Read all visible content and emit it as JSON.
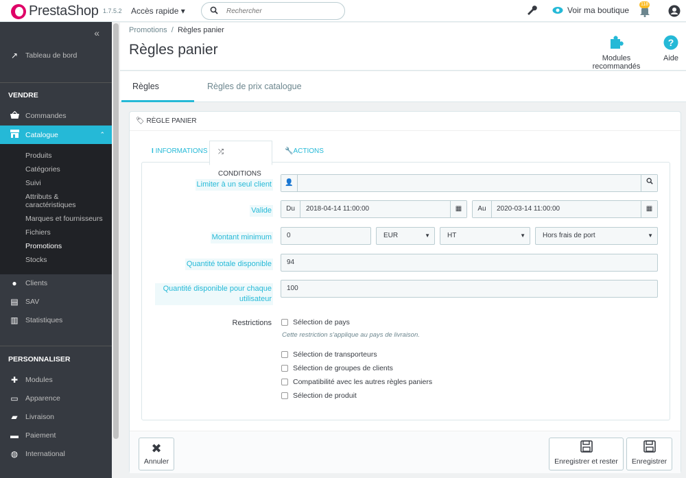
{
  "topbar": {
    "brand": "PrestaShop",
    "version": "1.7.5.2",
    "quick_access": "Accès rapide",
    "search_placeholder": "Rechercher",
    "view_shop": "Voir ma boutique",
    "notif_count": "118"
  },
  "sidebar": {
    "dashboard": "Tableau de bord",
    "section_sell": "VENDRE",
    "orders": "Commandes",
    "catalog": "Catalogue",
    "catalog_sub": [
      "Produits",
      "Catégories",
      "Suivi",
      "Attributs &\ncaractéristiques",
      "Marques et fournisseurs",
      "Fichiers",
      "Promotions",
      "Stocks"
    ],
    "customers": "Clients",
    "sav": "SAV",
    "stats": "Statistiques",
    "section_custom": "PERSONNALISER",
    "modules": "Modules",
    "design": "Apparence",
    "shipping": "Livraison",
    "payment": "Paiement",
    "international": "International"
  },
  "header": {
    "breadcrumb_parent": "Promotions",
    "breadcrumb_sep": "/",
    "breadcrumb_current": "Règles panier",
    "title": "Règles panier",
    "recommended_modules": "Modules recommandés",
    "help": "Aide"
  },
  "tabs": [
    "Règles panier",
    "Règles de prix catalogue"
  ],
  "panel": {
    "heading": "Règle panier",
    "subtabs": [
      "Informations",
      "Conditions",
      "Actions"
    ],
    "limit_customer_label": "Limiter à un seul client",
    "limit_customer_value": "",
    "valid_label": "Valide",
    "from_prefix": "Du",
    "from_value": "2018-04-14 11:00:00",
    "to_prefix": "Au",
    "to_value": "2020-03-14 11:00:00",
    "min_amount_label": "Montant minimum",
    "min_amount_value": "0",
    "currency": "EUR",
    "tax": "HT",
    "shipping": "Hors frais de port",
    "total_qty_label": "Quantité totale disponible",
    "total_qty_value": "94",
    "per_user_label": "Quantité disponible pour chaque utilisateur",
    "per_user_value": "100",
    "restrictions_label": "Restrictions",
    "restrictions": [
      "Sélection de pays",
      "Sélection de transporteurs",
      "Sélection de groupes de clients",
      "Compatibilité avec les autres règles paniers",
      "Sélection de produit"
    ],
    "country_hint": "Cette restriction s'applique au pays de livraison.",
    "cancel": "Annuler",
    "save_stay": "Enregistrer et rester",
    "save": "Enregistrer"
  },
  "colors": {
    "accent": "#25b9d7",
    "sidebar": "#363a41",
    "brand": "#df0067"
  }
}
